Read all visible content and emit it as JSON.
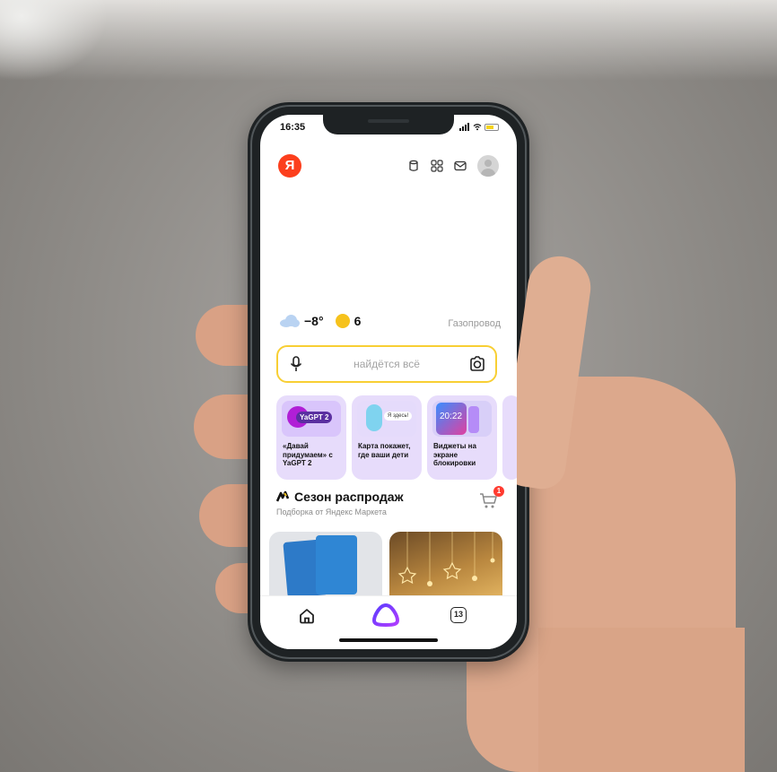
{
  "status_bar": {
    "time": "16:35"
  },
  "header": {
    "logo_letter": "Я"
  },
  "weather": {
    "temperature": "−8°",
    "traffic_score": "6",
    "district": "Газопровод"
  },
  "search": {
    "placeholder": "найдётся всё"
  },
  "stories": [
    {
      "text": "«Давай придумаем» с YaGPT 2",
      "badge": "YaGPT 2"
    },
    {
      "text": "Карта покажет, где ваши дети",
      "badge": "Я здесь!"
    },
    {
      "text": "Виджеты на экране блокировки",
      "badge": "20:22"
    }
  ],
  "promo": {
    "title": "Сезон распродаж",
    "subtitle": "Подборка от Яндекс Маркета",
    "cart_count": "1"
  },
  "bottom_nav": {
    "tabs_count": "13"
  },
  "colors": {
    "yandex_red": "#fc3f1d",
    "search_border": "#f8cf34",
    "alice_purple": "#7b3cff",
    "story_bg": "#e7dcfb"
  }
}
